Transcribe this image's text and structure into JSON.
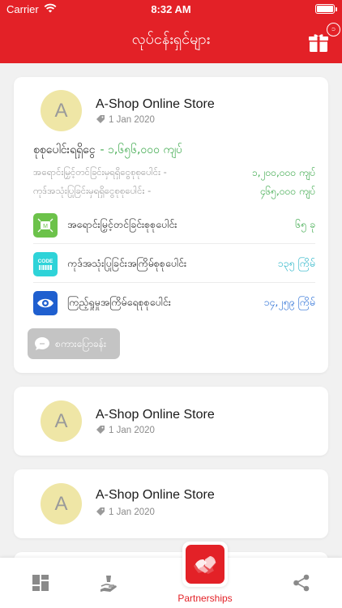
{
  "status_bar": {
    "carrier": "Carrier",
    "time": "8:32 AM"
  },
  "header": {
    "title": "လုပ်ငန်းရှင်များ",
    "gift_badge": "၁"
  },
  "cards": [
    {
      "avatar_letter": "A",
      "store_name": "A-Shop Online Store",
      "date": "1 Jan 2020",
      "total_label": "စုစုပေါင်းရရှိငွေ",
      "total_value": "- ၁,၆၅၆,၀၀၀ ကျပ်",
      "sub_rows": [
        {
          "label": "အရောင်းမြှင့်တင်ခြင်းမှရရှိငွေစုစုပေါင်း   -",
          "value": "၁,၂၀၀,၀၀၀ ကျပ်"
        },
        {
          "label": "ကုဒ်အသုံးပြုခြင်းမှရရှိငွေစုစုပေါင်း      -",
          "value": "၄၆၅,၀၀၀ ကျပ်"
        }
      ],
      "stats": [
        {
          "label": "အရောင်းမြှင့်တင်ခြင်းစုစုပေါင်း",
          "value": "၆၅ ခု",
          "color": "#3ba84a",
          "icon": "promotion-icon",
          "icon_color": "#6cc24a",
          "icon_text": ""
        },
        {
          "label": "ကုဒ်အသုံးပြုခြင်းအကြိမ်စုစုပေါင်း",
          "value": "၁၃၅ ကြိမ်",
          "color": "#2bb5c8",
          "icon": "code-icon",
          "icon_color": "#2ed3d8",
          "icon_text": "CODE"
        },
        {
          "label": "ကြည့်ရှုမှုအကြိမ်ရေစုစုပေါင်း",
          "value": "၁၄,၂၅၉ ကြိမ်",
          "color": "#2a6fd6",
          "icon": "eye-icon",
          "icon_color": "#1f5fcf",
          "icon_text": ""
        }
      ],
      "message_button": "စကားပြောခန်း"
    },
    {
      "avatar_letter": "A",
      "store_name": "A-Shop Online Store",
      "date": "1 Jan 2020"
    },
    {
      "avatar_letter": "A",
      "store_name": "A-Shop Online Store",
      "date": "1 Jan 2020"
    }
  ],
  "tabbar": {
    "tabs": [
      {
        "icon": "dashboard-icon"
      },
      {
        "icon": "hand-money-icon"
      },
      {
        "icon": "partnerships-icon",
        "label": "Partnerships",
        "active": true
      },
      {
        "icon": "share-icon"
      }
    ]
  },
  "colors": {
    "brand_red": "#e32127",
    "positive_green": "#3ba84a"
  }
}
